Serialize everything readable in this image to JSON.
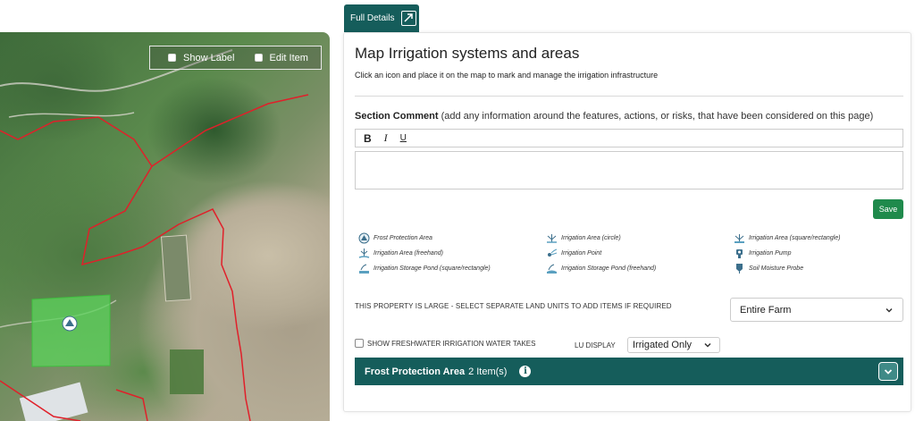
{
  "map": {
    "show_label": "Show Label",
    "edit_item": "Edit Item"
  },
  "tab": {
    "label": "Full Details"
  },
  "panel": {
    "title": "Map Irrigation systems and areas",
    "subtitle": "Click an icon and place it on the map to mark and manage the irrigation infrastructure",
    "comment_label_bold": "Section Comment",
    "comment_label_rest": " (add any information around the features, actions, or risks, that have been considered on this page)",
    "toolbar": {
      "bold": "B",
      "italic": "I",
      "underline": "U"
    },
    "save_label": "Save",
    "legend": [
      {
        "label": "Frost Protection Area",
        "icon": "frost-protection-icon"
      },
      {
        "label": "Irrigation Area (circle)",
        "icon": "irrigation-circle-icon"
      },
      {
        "label": "Irrigation Area (square/rectangle)",
        "icon": "irrigation-square-icon"
      },
      {
        "label": "Irrigation Area (freehand)",
        "icon": "irrigation-freehand-icon"
      },
      {
        "label": "Irrigation Point",
        "icon": "irrigation-point-icon"
      },
      {
        "label": "Irrigation Pump",
        "icon": "irrigation-pump-icon"
      },
      {
        "label": "Irrigation Storage Pond (square/rectangle)",
        "icon": "storage-pond-square-icon"
      },
      {
        "label": "Irrigation Storage Pond (freehand)",
        "icon": "storage-pond-freehand-icon"
      },
      {
        "label": "Soil Moisture Probe",
        "icon": "soil-moisture-probe-icon"
      }
    ],
    "large_note": "THIS PROPERTY IS LARGE - SELECT SEPARATE LAND UNITS TO ADD ITEMS IF REQUIRED",
    "farm_select_value": "Entire Farm",
    "freshwater_label": "SHOW FRESHWATER IRRIGATION WATER TAKES",
    "lu_display_label": "LU DISPLAY",
    "lu_display_value": "Irrigated Only",
    "accordion": {
      "title": "Frost Protection Area",
      "count": "2 Item(s)"
    }
  },
  "colors": {
    "accent": "#155d5b",
    "save": "#1f8a4c",
    "boundary": "#e0202a",
    "area_fill": "#5bd35b"
  }
}
